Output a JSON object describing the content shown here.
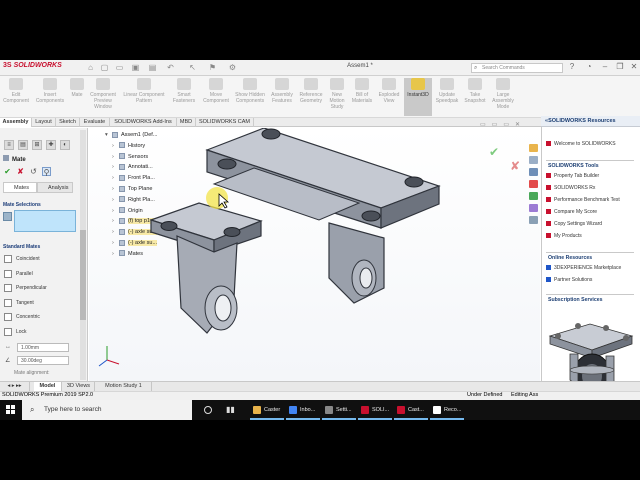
{
  "app": {
    "brand": "SOLIDWORKS",
    "document_title": "Assem1 *",
    "search_placeholder": "Search Commands"
  },
  "toolbar": {
    "tools": [
      {
        "label": "Edit Component",
        "icon": "edit-component-icon"
      },
      {
        "label": "Insert Components",
        "icon": "insert-components-icon"
      },
      {
        "label": "Mate",
        "icon": "mate-icon"
      },
      {
        "label": "Component Preview Window",
        "icon": "preview-window-icon"
      },
      {
        "label": "Linear Component Pattern",
        "icon": "pattern-icon"
      },
      {
        "label": "Smart Fasteners",
        "icon": "fasteners-icon"
      },
      {
        "label": "Move Component",
        "icon": "move-component-icon"
      },
      {
        "label": "Show Hidden Components",
        "icon": "show-hidden-icon"
      },
      {
        "label": "Assembly Features",
        "icon": "assembly-features-icon"
      },
      {
        "label": "Reference Geometry",
        "icon": "reference-geometry-icon"
      },
      {
        "label": "New Motion Study",
        "icon": "motion-study-icon"
      },
      {
        "label": "Bill of Materials",
        "icon": "bom-icon"
      },
      {
        "label": "Exploded View",
        "icon": "exploded-view-icon"
      },
      {
        "label": "Instant3D",
        "icon": "instant3d-icon"
      },
      {
        "label": "Update Speedpak",
        "icon": "speedpak-icon"
      },
      {
        "label": "Take Snapshot",
        "icon": "snapshot-icon"
      },
      {
        "label": "Large Assembly Mode",
        "icon": "large-assembly-icon"
      }
    ]
  },
  "tabs": [
    "Assembly",
    "Layout",
    "Sketch",
    "Evaluate",
    "SOLIDWORKS Add-Ins",
    "MBD",
    "SOLIDWORKS CAM"
  ],
  "property_manager": {
    "title": "Mate",
    "subtabs": [
      "Mates",
      "Analysis"
    ],
    "mate_selections_label": "Mate Selections",
    "standard_mates_label": "Standard Mates",
    "standard_mates": [
      "Coincident",
      "Parallel",
      "Perpendicular",
      "Tangent",
      "Concentric",
      "Lock"
    ],
    "distance_value": "1.00mm",
    "angle_value": "30.00deg",
    "mate_alignment_label": "Mate alignment:"
  },
  "feature_tree": [
    {
      "label": "Assem1 (Def...",
      "indent": 0
    },
    {
      "label": "History",
      "indent": 1
    },
    {
      "label": "Sensors",
      "indent": 1
    },
    {
      "label": "Annotati...",
      "indent": 1
    },
    {
      "label": "Front Pla...",
      "indent": 1
    },
    {
      "label": "Top Plane",
      "indent": 1
    },
    {
      "label": "Right Pla...",
      "indent": 1
    },
    {
      "label": "Origin",
      "indent": 1
    },
    {
      "label": "(f) top p1...",
      "indent": 1,
      "highlight": true
    },
    {
      "label": "(-) axle su...",
      "indent": 1,
      "highlight": true
    },
    {
      "label": "(-) axle su...",
      "indent": 1,
      "highlight": true
    },
    {
      "label": "Mates",
      "indent": 1
    }
  ],
  "bottom_tabs": [
    "Model",
    "3D Views",
    "Motion Study 1"
  ],
  "status": {
    "product": "SOLIDWORKS Premium 2019 SP2.0",
    "state": "Under Defined",
    "mode": "Editing Ass"
  },
  "task_pane": {
    "title": "SOLIDWORKS Resources",
    "welcome": "Welcome to SOLIDWORKS",
    "tools_header": "SOLIDWORKS Tools",
    "tools": [
      "Property Tab Builder",
      "SOLIDWORKS Rx",
      "Performance Benchmark Test",
      "Compare My Score",
      "Copy Settings Wizard",
      "My Products"
    ],
    "online_header": "Online Resources",
    "online": [
      "3DEXPERIENCE Marketplace",
      "Partner Solutions"
    ],
    "subscription_header": "Subscription Services"
  },
  "taskbar": {
    "search_text": "Type here to search",
    "apps": [
      {
        "label": "Caster",
        "color": "#e8b34b"
      },
      {
        "label": "Inbo...",
        "color": "#4285f4"
      },
      {
        "label": "Setti...",
        "color": "#888888"
      },
      {
        "label": "SOLI...",
        "color": "#c8102e"
      },
      {
        "label": "Cast...",
        "color": "#c8102e"
      },
      {
        "label": "Reco...",
        "color": "#ffffff"
      }
    ]
  }
}
